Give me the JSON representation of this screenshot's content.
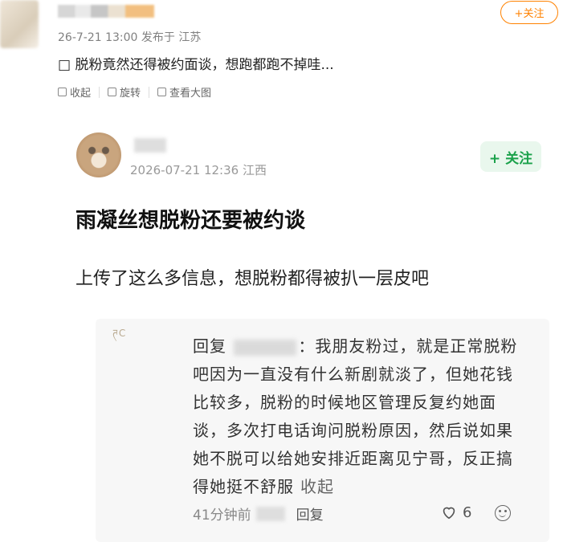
{
  "post": {
    "date": "26-7-21 13:00",
    "published_from": "发布于 江苏",
    "follow_label": "+关注",
    "text": "脱粉竟然还得被约面谈，想跑都跑不掉哇...",
    "text_prefix_glyph": "□"
  },
  "toolbar": {
    "collapse_label": "收起",
    "rotate_label": "旋转",
    "view_large_label": "查看大图"
  },
  "screenshot": {
    "date": "2026-07-21 12:36",
    "location": "江西",
    "follow_label": "+ 关注",
    "title": "雨凝丝想脱粉还要被约谈",
    "body": "上传了这么多信息，想脱粉都得被扒一层皮吧",
    "reply": {
      "avatar_text": "ཊC",
      "prefix": "回复",
      "name_suffix": "：",
      "text": "我朋友粉过，就是正常脱粉吧因为一直没有什么新剧就淡了，但她花钱比较多，脱粉的时候地区管理反复约她面谈，多次打电话询问脱粉原因，然后说如果她不脱可以给她安排近距离见宁哥，反正搞得她挺不舒服",
      "collapse_label": "收起",
      "time": "41分钟前",
      "reply_label": "回复",
      "likes": "6"
    }
  },
  "colors": {
    "accent_orange": "#ff8200",
    "follow_green": "#1aa14a"
  }
}
